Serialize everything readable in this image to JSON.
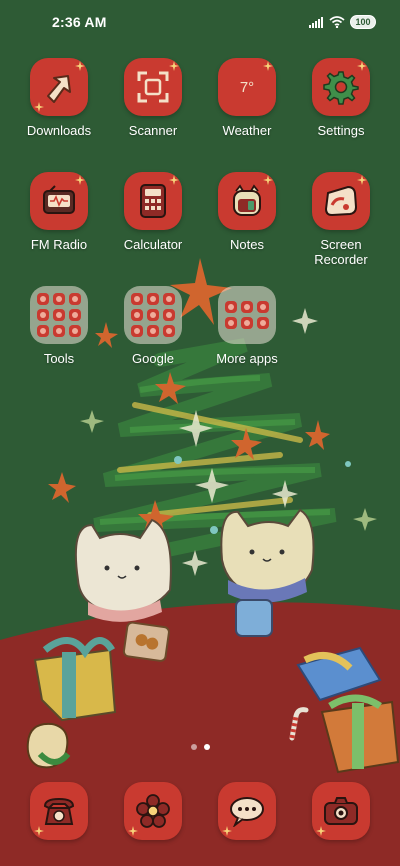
{
  "status_bar": {
    "time": "2:36 AM",
    "battery": "100",
    "icons": [
      "signal-icon",
      "wifi-icon",
      "battery-icon"
    ]
  },
  "apps": [
    {
      "label": "Downloads",
      "icon": "download-icon"
    },
    {
      "label": "Scanner",
      "icon": "scanner-icon"
    },
    {
      "label": "Weather",
      "icon": "weather-icon",
      "badge": "7°"
    },
    {
      "label": "Settings",
      "icon": "gear-icon"
    },
    {
      "label": "FM Radio",
      "icon": "radio-icon"
    },
    {
      "label": "Calculator",
      "icon": "calculator-icon"
    },
    {
      "label": "Notes",
      "icon": "notes-icon"
    },
    {
      "label": "Screen\nRecorder",
      "icon": "screen-recorder-icon"
    }
  ],
  "folders": [
    {
      "label": "Tools"
    },
    {
      "label": "Google"
    },
    {
      "label": "More apps"
    }
  ],
  "page_indicator": {
    "pages": 2,
    "active": 2
  },
  "dock": [
    {
      "icon": "phone-icon"
    },
    {
      "icon": "gallery-icon"
    },
    {
      "icon": "messages-icon"
    },
    {
      "icon": "camera-icon"
    }
  ],
  "colors": {
    "wallpaper_green": "#2e5b35",
    "table_red": "#8e2a26",
    "icon_red": "#c93a30"
  }
}
